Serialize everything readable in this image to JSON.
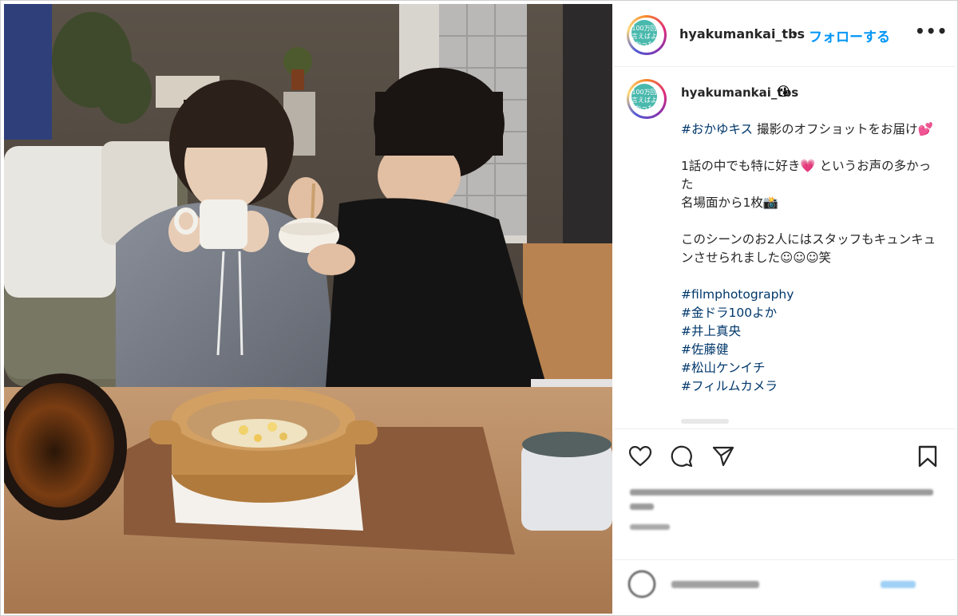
{
  "post": {
    "username": "hyakumankai_tbs",
    "separator": "•",
    "follow_label": "フォローする",
    "more_label": "•••",
    "avatar_text": "100万回言えばよかった",
    "caption_emoji": "😘",
    "caption_lines": [
      {
        "tag": "#おかゆキス",
        "text": " 撮影のオフショットをお届け💕"
      },
      {
        "gap": true
      },
      {
        "text": "1話の中でも特に好き💗 というお声の多かった"
      },
      {
        "text": "名場面から1枚📸"
      },
      {
        "gap": true
      },
      {
        "text": "このシーンのお2人にはスタッフもキュンキュンさせられました☺☺☺笑"
      },
      {
        "gap": true
      },
      {
        "tag": "#filmphotography"
      },
      {
        "tag": "#金ドラ100よか"
      },
      {
        "tag": "#井上真央"
      },
      {
        "tag": "#佐藤健"
      },
      {
        "tag": "#松山ケンイチ"
      },
      {
        "tag": "#フィルムカメラ"
      }
    ]
  },
  "actions": {
    "like_icon": "heart-icon",
    "comment_icon": "comment-icon",
    "share_icon": "share-icon",
    "save_icon": "bookmark-icon"
  },
  "comment": {
    "emoji_icon": "smiley-icon"
  },
  "colors": {
    "link_blue": "#0095f6",
    "hashtag": "#00376b",
    "text": "#262626",
    "muted": "#8e8e8e"
  }
}
